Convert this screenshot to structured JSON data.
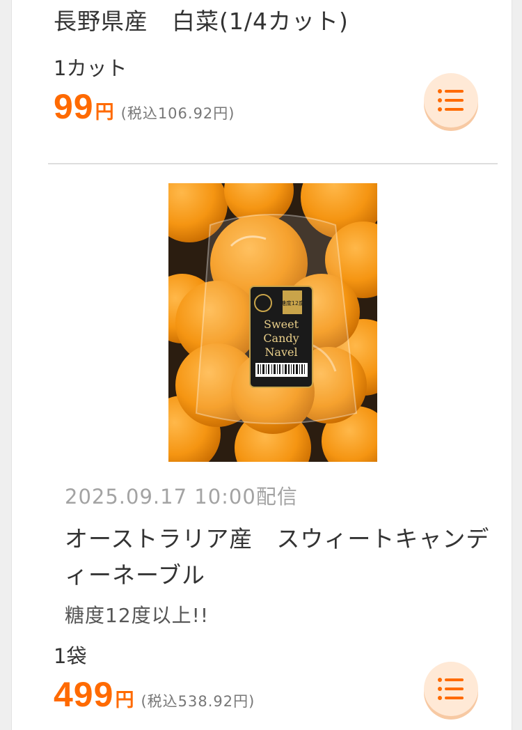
{
  "products": [
    {
      "title": "長野県産　白菜(1/4カット)",
      "unit": "1カット",
      "price": "99",
      "yen": "円",
      "tax_price": "(税込106.92円)"
    },
    {
      "date": "2025.09.17 10:00配信",
      "title": "オーストラリア産　スウィートキャンディーネーブル",
      "description": "糖度12度以上!!",
      "unit": "1袋",
      "price": "499",
      "yen": "円",
      "tax_price": "(税込538.92円)",
      "image_label": {
        "title_line1": "Sweet",
        "title_line2": "Candy",
        "title_line3": "Navel",
        "badge": "糖度12度"
      }
    }
  ],
  "colors": {
    "price": "#ff6a00",
    "button_bg": "#ffe9d6",
    "icon": "#ff6a00"
  },
  "icons": {
    "list_button": "list-icon"
  }
}
